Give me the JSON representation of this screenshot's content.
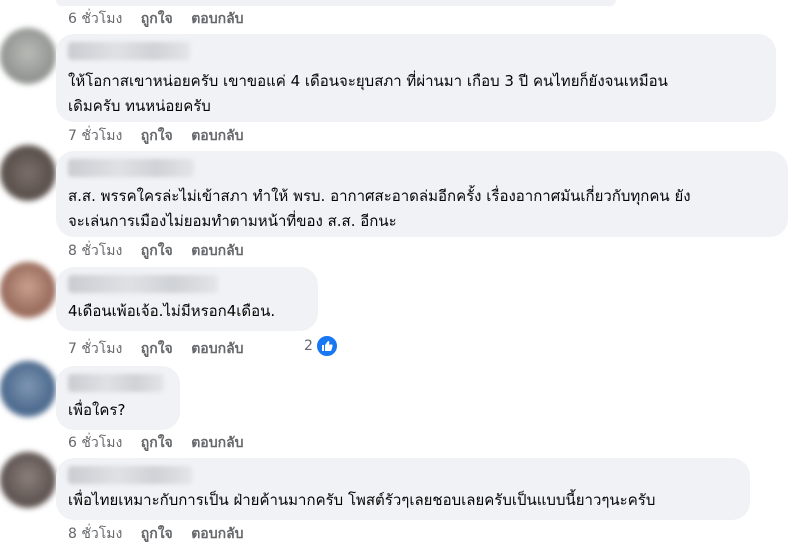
{
  "actions": {
    "like": "ถูกใจ",
    "reply": "ตอบกลับ"
  },
  "top_meta": {
    "time": "6 ชั่วโมง"
  },
  "comments": [
    {
      "lines": [
        "ให้โอกาสเขาหน่อยครับ เขาขอแค่ 4 เดือนจะยุบสภา ที่ผ่านมา เกือบ 3 ปี คนไทยก็ยังจนเหมือน",
        "เดิมครับ ทนหน่อยครับ"
      ],
      "time": "7 ชั่วโมง"
    },
    {
      "lines": [
        "ส.ส. พรรคใครล่ะไม่เข้าสภา ทำให้ พรบ. อากาศสะอาดล่มอีกครั้ง เรื่องอากาศมันเกี่ยวกับทุกคน ยัง",
        "จะเล่นการเมืองไม่ยอมทำตามหน้าที่ของ ส.ส. อีกนะ"
      ],
      "time": "8 ชั่วโมง"
    },
    {
      "lines": [
        "4เดือนเพ้อเจ้อ.ไม่มีหรอก4เดือน."
      ],
      "time": "7 ชั่วโมง",
      "reactions": "2"
    },
    {
      "lines": [
        "เพื่อใคร?"
      ],
      "time": "6 ชั่วโมง"
    },
    {
      "lines": [
        "เพื่อไทยเหมาะกับการเป็น ฝ่ายค้านมากครับ โพสต์รัวๆเลยชอบเลยครับเป็นแบบนี้ยาวๆนะครับ"
      ],
      "time": "8 ชั่วโมง"
    }
  ],
  "colors": {
    "bubble": "#f0f2f5",
    "meta": "#65676b",
    "like": "#1877f2"
  }
}
